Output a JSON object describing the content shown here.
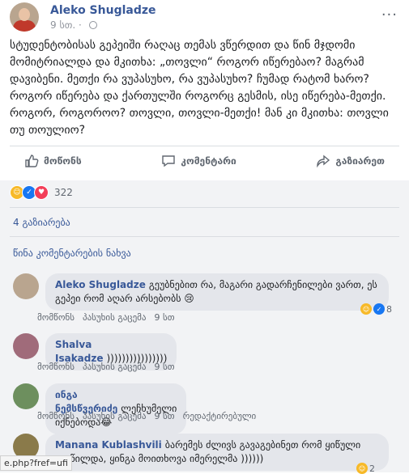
{
  "post": {
    "author": "Aleko Shugladze",
    "time": "9 სთ. ·",
    "more": "···",
    "text": "სტუდენტობისას გეპეიში რაღაც თემას ვწერდით და წინ მჯდომი მომიტრიალდა და მკითხა: „თოვლი“ როგორ იწერებაო? მაგრამ დავიბენი. მეთქი რა ვუპასუხო, რა ვუპასუხო? ჩუმად რატომ ხარო? როგორ იწერება და ქართულში როგორც გესმის, ისე იწერება-მეთქი. როგორ, როგოროო? თოვლი, თოვლი-მეთქი! მან კი მკითხა: თოვლი თუ თოულიო?"
  },
  "actions": {
    "like": "მოწონს",
    "comment": "კომენტარი",
    "share": "გაზიარეთ"
  },
  "reactions": {
    "count": "322"
  },
  "shares": "4 გაზიარება",
  "previous_comments": "წინა კომენტარების ნახვა",
  "comments": [
    {
      "name": "Aleko Shugladze",
      "text": "გეუბნებით რა, მაგარი გადარჩენილები ვართ, ეს გეპეი რომ აღარ არსებობს 😢",
      "like": "მომწონს",
      "reply": "პასუხის გაცემა",
      "time": "9 სთ",
      "reacts": "8",
      "edited": ""
    },
    {
      "name": "Shalva Isakadze",
      "text": "))))))))))))))))",
      "like": "მომწონს",
      "reply": "პასუხის გაცემა",
      "time": "9 სთ",
      "reacts": "",
      "edited": ""
    },
    {
      "name": "ინგა ნემსწვერიძე",
      "text": "ლეჩხუმელი იქნებოდა😂",
      "like": "მომწონს",
      "reply": "პასუხის გაცემა",
      "time": "9 სთ",
      "reacts": "",
      "edited": "რედაქტირებული"
    },
    {
      "name": "Manana Kublashvili",
      "text": "ბარემეს ძლივს გავაგებინეთ რომ ყიწული ავიწილდა, ყინგა მოითხოვა იმერელმა ))))))",
      "like": "",
      "reply": "",
      "time": "",
      "reacts": "2",
      "edited": ""
    }
  ],
  "statusbar": "e.php?fref=ufi"
}
